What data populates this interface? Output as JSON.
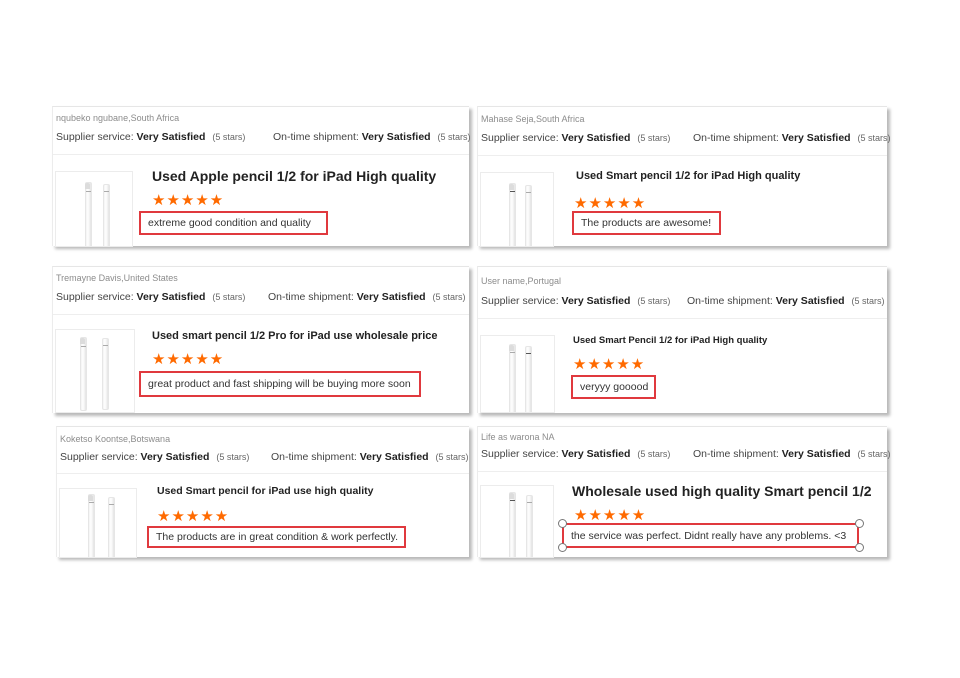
{
  "labels": {
    "supplier": "Supplier service:",
    "shipment": "On-time shipment:",
    "value": "Very Satisfied",
    "stars_count": "(5 stars)",
    "stars": "★★★★★"
  },
  "colors": {
    "star": "#ff6a00",
    "highlight": "#e0393e"
  },
  "reviews": [
    {
      "reviewer": "nqubeko ngubane,South Africa",
      "title": "Used Apple pencil 1/2 for iPad High quality",
      "text": "extreme good condition and quality"
    },
    {
      "reviewer": "Mahase Seja,South Africa",
      "title": "Used Smart pencil 1/2 for iPad High quality",
      "text": "The products are awesome!"
    },
    {
      "reviewer": "Tremayne Davis,United States",
      "title": "Used smart pencil 1/2 Pro for iPad use wholesale price",
      "text": "great product and fast shipping will be buying more soon"
    },
    {
      "reviewer": "User name,Portugal",
      "title": "Used Smart Pencil 1/2 for iPad High quality",
      "text": "veryyy gooood"
    },
    {
      "reviewer": "Koketso Koontse,Botswana",
      "title": "Used Smart pencil for iPad use high quality",
      "text": "The products are in great condition & work perfectly."
    },
    {
      "reviewer": "Life as warona NA",
      "title": "Wholesale used high quality Smart pencil 1/2",
      "text": "the service was perfect. Didnt really have any problems. <3"
    }
  ]
}
